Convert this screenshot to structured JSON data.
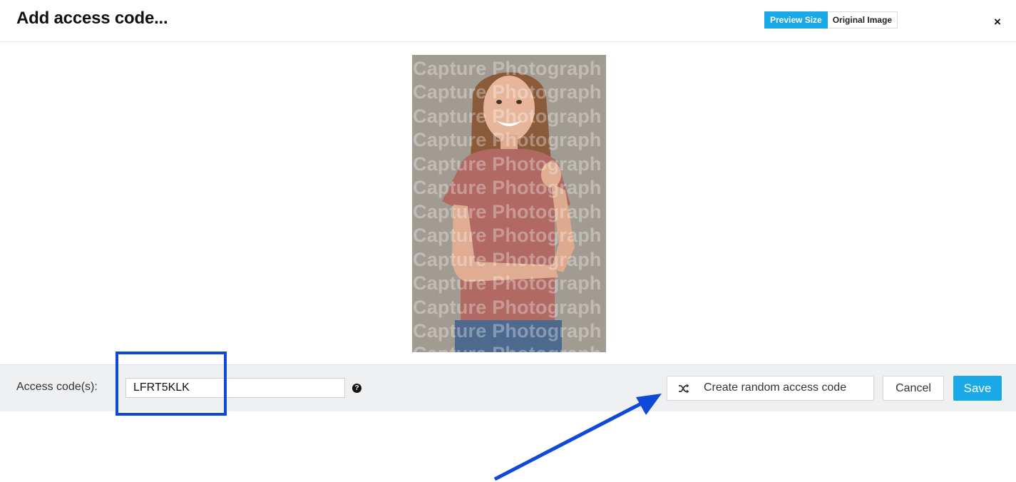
{
  "dialog": {
    "title": "Add access code...",
    "close_symbol": "×"
  },
  "view_toggle": {
    "preview_label": "Preview Size",
    "original_label": "Original Image",
    "selected": "Preview Size"
  },
  "photo": {
    "watermark_text": "Capture Photograph",
    "watermark_lines": [
      "Capture Photograph",
      "Capture Photograph",
      "Capture Photograph",
      "Capture Photograph",
      "Capture Photograph",
      "Capture Photograph",
      "Capture Photograph",
      "Capture Photograph",
      "Capture Photograph",
      "Capture Photograph",
      "Capture Photograph",
      "Capture Photograph",
      "Capture Photograph"
    ]
  },
  "footer": {
    "access_label": "Access code(s):",
    "access_value": "LFRT5KLK",
    "help_symbol": "?",
    "random_button_label": "Create random access code",
    "cancel_label": "Cancel",
    "save_label": "Save"
  },
  "colors": {
    "accent": "#19a9e6",
    "annotation": "#1048d8",
    "footer_bg": "#eff0f2"
  }
}
